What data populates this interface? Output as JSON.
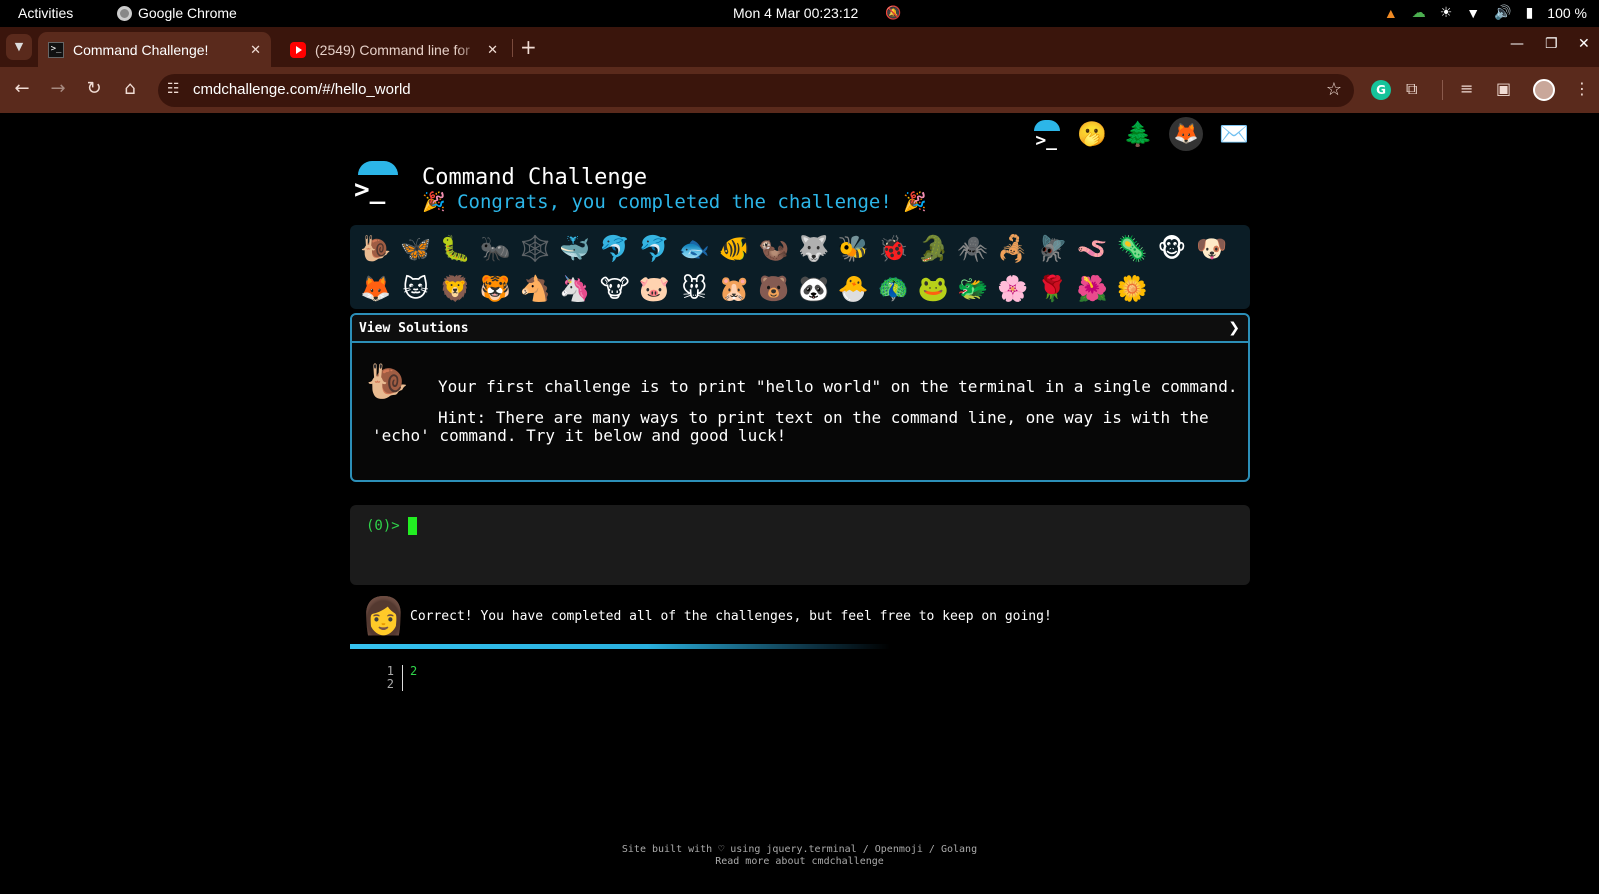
{
  "system_bar": {
    "activities": "Activities",
    "app_name": "Google Chrome",
    "clock": "Mon 4 Mar  00:23:12",
    "battery": "100 %"
  },
  "tabs": [
    {
      "title": "Command Challenge!",
      "icon": "terminal-favicon-icon",
      "active": true
    },
    {
      "title": "(2549) Command line for",
      "icon": "youtube-icon",
      "active": false
    }
  ],
  "address_bar": {
    "url": "cmdchallenge.com/#/hello_world"
  },
  "page": {
    "site_title": "Command Challenge",
    "congrats": "🎉 Congrats, you completed the challenge! 🎉",
    "header_links": [
      "🫢",
      "🌲",
      "🦊",
      "✉️"
    ],
    "emojis": [
      "🐌",
      "🦋",
      "🐛",
      "🐜",
      "🕸️",
      "🐳",
      "🐬",
      "🐬",
      "🐟",
      "🐠",
      "🦦",
      "🐺",
      "🐝",
      "🐞",
      "🐊",
      "🕷️",
      "🦂",
      "🪰",
      "🪱",
      "🦠",
      "🐵",
      "🐶",
      "🦊",
      "🐱",
      "🦁",
      "🐯",
      "🐴",
      "🦄",
      "🐮",
      "🐷",
      "🐭",
      "🐹",
      "🐻",
      "🐼",
      "🐣",
      "🦚",
      "🐸",
      "🐲",
      "🌸",
      "🌹",
      "🌺",
      "🌼"
    ],
    "solutions_label": "View Solutions",
    "challenge_icon": "🐌",
    "challenge_text": "Your first challenge is to print \"hello world\" on the terminal in a single command.",
    "hint_line1": "Hint: There are many ways to print text on the command line, one way is with the",
    "hint_line2": "'echo' command. Try it below and good luck!",
    "terminal_prompt": "(0)>",
    "status_icon": "👩",
    "status_message": "Correct! You have completed all of the challenges, but feel free to keep on going!",
    "progress": 0.6,
    "editor_line_numbers": "1\n2",
    "editor_content": "2",
    "footer_line1": "Site built with ♡ using jquery.terminal / Openmoji / Golang",
    "footer_line2": "Read more about cmdchallenge"
  },
  "colors": {
    "accent": "#2cb6e8",
    "prompt_green": "#2fd44a",
    "tab_strip": "#3a150c",
    "toolbar": "#5a2a1c"
  }
}
